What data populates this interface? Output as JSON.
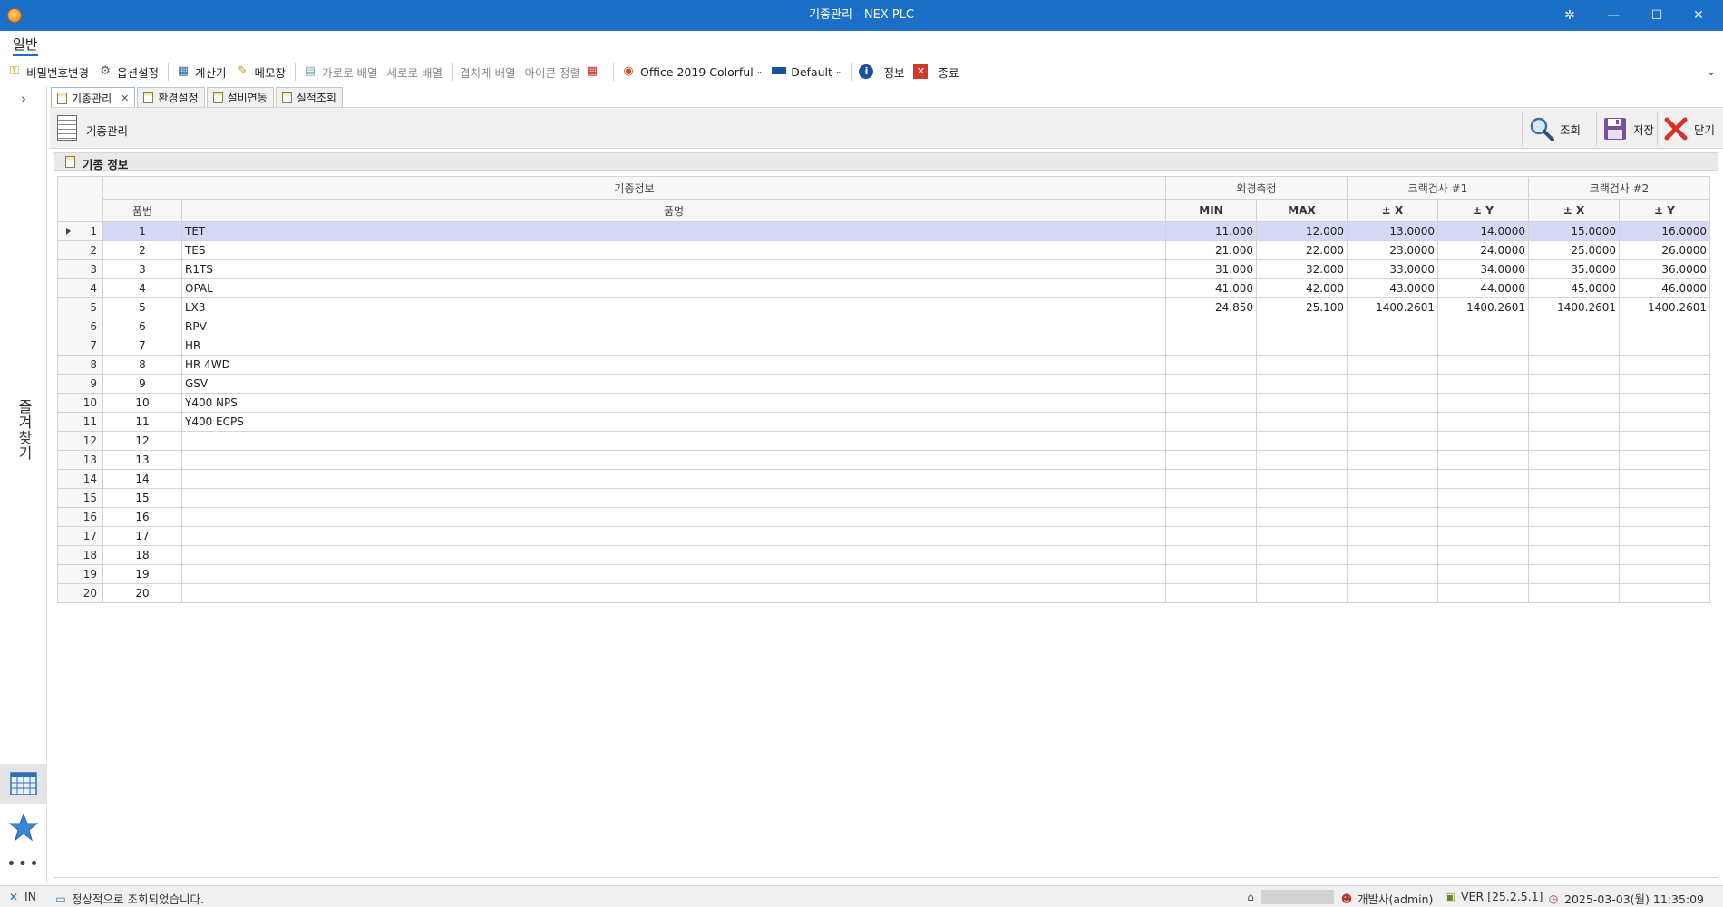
{
  "window": {
    "title": "기종관리 - NEX-PLC"
  },
  "ribbon": {
    "tab": "일반"
  },
  "toolbar": {
    "items": [
      {
        "label": "비밀번호변경",
        "icon": "key-icon"
      },
      {
        "label": "옵션설정",
        "icon": "gear-icon"
      },
      {
        "label": "계산기",
        "icon": "calculator-icon"
      },
      {
        "label": "메모장",
        "icon": "notepad-icon"
      },
      {
        "label": "가로로 배열",
        "icon": "tile-horizontal-icon"
      },
      {
        "label": "세로로 배열"
      },
      {
        "label": "겹치게 배열"
      },
      {
        "label": "아이콘 정렬"
      },
      {
        "label": "Office 2019 Colorful",
        "icon": "office-icon"
      },
      {
        "label": "Default",
        "icon": "palette-icon"
      },
      {
        "label": "정보",
        "icon": "info-icon"
      },
      {
        "label": "종료",
        "icon": "exit-icon"
      }
    ]
  },
  "leftnav": {
    "vertical_label": "즐겨찾기"
  },
  "doc_tabs": [
    {
      "label": "기종관리"
    },
    {
      "label": "환경설정"
    },
    {
      "label": "설비연동"
    },
    {
      "label": "실적조회"
    }
  ],
  "form": {
    "name": "기종관리",
    "buttons": {
      "search": "조회",
      "save": "저장",
      "close": "닫기"
    }
  },
  "group": {
    "title": "기종 정보"
  },
  "grid": {
    "bands": [
      "기종정보",
      "외경측정",
      "크랙검사 #1",
      "크랙검사 #2"
    ],
    "columns": [
      "품번",
      "품명",
      "MIN",
      "MAX",
      "± X",
      "± Y",
      "± X",
      "± Y"
    ],
    "rows": [
      {
        "n": "1",
        "code": "1",
        "name": "TET",
        "min": "11.000",
        "max": "12.000",
        "x1": "13.0000",
        "y1": "14.0000",
        "x2": "15.0000",
        "y2": "16.0000"
      },
      {
        "n": "2",
        "code": "2",
        "name": "TES",
        "min": "21.000",
        "max": "22.000",
        "x1": "23.0000",
        "y1": "24.0000",
        "x2": "25.0000",
        "y2": "26.0000"
      },
      {
        "n": "3",
        "code": "3",
        "name": "R1TS",
        "min": "31.000",
        "max": "32.000",
        "x1": "33.0000",
        "y1": "34.0000",
        "x2": "35.0000",
        "y2": "36.0000"
      },
      {
        "n": "4",
        "code": "4",
        "name": "OPAL",
        "min": "41.000",
        "max": "42.000",
        "x1": "43.0000",
        "y1": "44.0000",
        "x2": "45.0000",
        "y2": "46.0000"
      },
      {
        "n": "5",
        "code": "5",
        "name": "LX3",
        "min": "24.850",
        "max": "25.100",
        "x1": "1400.2601",
        "y1": "1400.2601",
        "x2": "1400.2601",
        "y2": "1400.2601"
      },
      {
        "n": "6",
        "code": "6",
        "name": "RPV",
        "min": "",
        "max": "",
        "x1": "",
        "y1": "",
        "x2": "",
        "y2": ""
      },
      {
        "n": "7",
        "code": "7",
        "name": "HR",
        "min": "",
        "max": "",
        "x1": "",
        "y1": "",
        "x2": "",
        "y2": ""
      },
      {
        "n": "8",
        "code": "8",
        "name": "HR 4WD",
        "min": "",
        "max": "",
        "x1": "",
        "y1": "",
        "x2": "",
        "y2": ""
      },
      {
        "n": "9",
        "code": "9",
        "name": "GSV",
        "min": "",
        "max": "",
        "x1": "",
        "y1": "",
        "x2": "",
        "y2": ""
      },
      {
        "n": "10",
        "code": "10",
        "name": "Y400 NPS",
        "min": "",
        "max": "",
        "x1": "",
        "y1": "",
        "x2": "",
        "y2": ""
      },
      {
        "n": "11",
        "code": "11",
        "name": "Y400 ECPS",
        "min": "",
        "max": "",
        "x1": "",
        "y1": "",
        "x2": "",
        "y2": ""
      },
      {
        "n": "12",
        "code": "12",
        "name": "",
        "min": "",
        "max": "",
        "x1": "",
        "y1": "",
        "x2": "",
        "y2": ""
      },
      {
        "n": "13",
        "code": "13",
        "name": "",
        "min": "",
        "max": "",
        "x1": "",
        "y1": "",
        "x2": "",
        "y2": ""
      },
      {
        "n": "14",
        "code": "14",
        "name": "",
        "min": "",
        "max": "",
        "x1": "",
        "y1": "",
        "x2": "",
        "y2": ""
      },
      {
        "n": "15",
        "code": "15",
        "name": "",
        "min": "",
        "max": "",
        "x1": "",
        "y1": "",
        "x2": "",
        "y2": ""
      },
      {
        "n": "16",
        "code": "16",
        "name": "",
        "min": "",
        "max": "",
        "x1": "",
        "y1": "",
        "x2": "",
        "y2": ""
      },
      {
        "n": "17",
        "code": "17",
        "name": "",
        "min": "",
        "max": "",
        "x1": "",
        "y1": "",
        "x2": "",
        "y2": ""
      },
      {
        "n": "18",
        "code": "18",
        "name": "",
        "min": "",
        "max": "",
        "x1": "",
        "y1": "",
        "x2": "",
        "y2": ""
      },
      {
        "n": "19",
        "code": "19",
        "name": "",
        "min": "",
        "max": "",
        "x1": "",
        "y1": "",
        "x2": "",
        "y2": ""
      },
      {
        "n": "20",
        "code": "20",
        "name": "",
        "min": "",
        "max": "",
        "x1": "",
        "y1": "",
        "x2": "",
        "y2": ""
      }
    ]
  },
  "status": {
    "mode": "IN",
    "message": "정상적으로 조회되었습니다.",
    "user": "개발사(admin)",
    "version": "VER [25.2.5.1]",
    "datetime": "2025-03-03(월) 11:35:09"
  },
  "colors": {
    "titlebar": "#1c6fc6",
    "selected_row": "#d5d9f5"
  }
}
